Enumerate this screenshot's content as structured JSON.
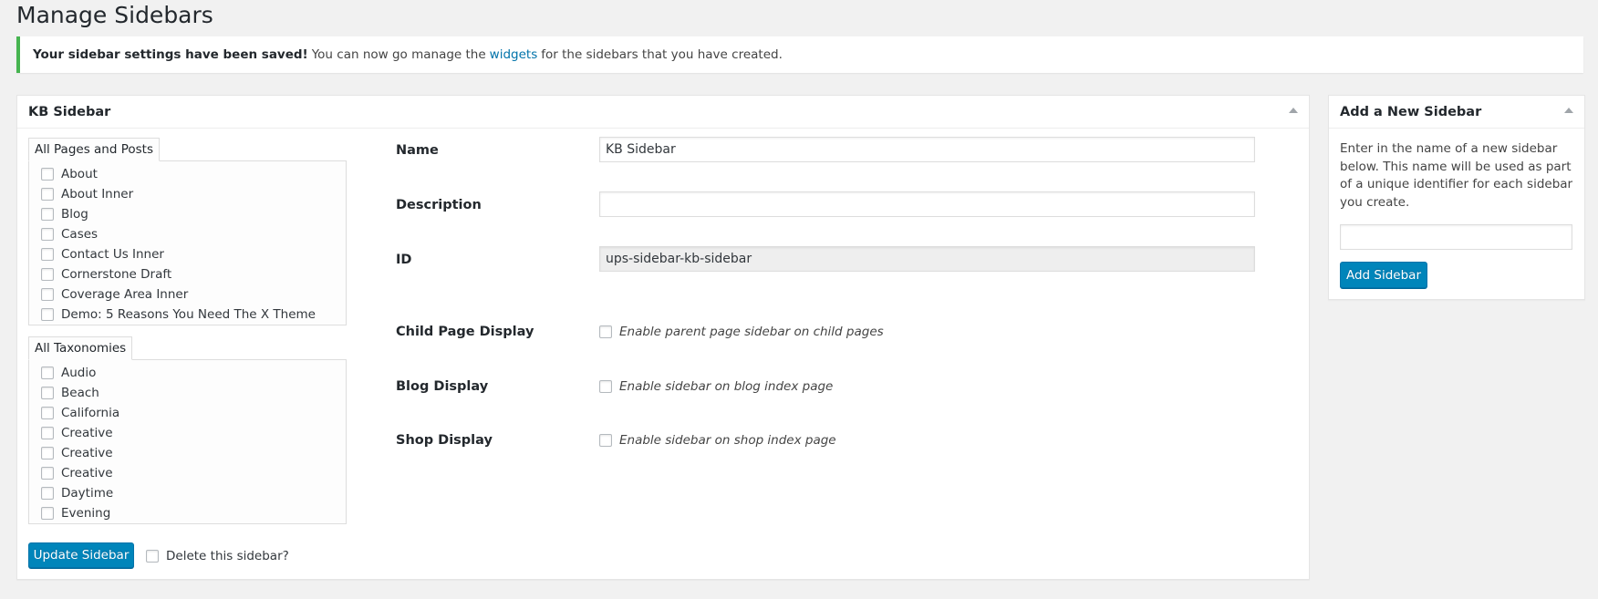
{
  "page": {
    "title": "Manage Sidebars"
  },
  "notice": {
    "bold": "Your sidebar settings have been saved!",
    "text_before": "You can now go manage the",
    "link": "widgets",
    "text_after": "for the sidebars that you have created."
  },
  "main_panel": {
    "title": "KB Sidebar",
    "pages_tab": {
      "label": "All Pages and Posts",
      "items": [
        "About",
        "About Inner",
        "Blog",
        "Cases",
        "Contact Us Inner",
        "Cornerstone Draft",
        "Coverage Area Inner",
        "Demo: 5 Reasons You Need The X Theme"
      ]
    },
    "taxonomies_tab": {
      "label": "All Taxonomies",
      "items": [
        "Audio",
        "Beach",
        "California",
        "Creative",
        "Creative",
        "Creative",
        "Daytime",
        "Evening"
      ]
    },
    "fields": {
      "name_label": "Name",
      "name_value": "KB Sidebar",
      "description_label": "Description",
      "description_value": "",
      "id_label": "ID",
      "id_value": "ups-sidebar-kb-sidebar",
      "child_label": "Child Page Display",
      "child_option": "Enable parent page sidebar on child pages",
      "blog_label": "Blog Display",
      "blog_option": "Enable sidebar on blog index page",
      "shop_label": "Shop Display",
      "shop_option": "Enable sidebar on shop index page"
    },
    "update_button": "Update Sidebar",
    "delete_label": "Delete this sidebar?"
  },
  "side_panel": {
    "title": "Add a New Sidebar",
    "description": "Enter in the name of a new sidebar below. This name will be used as part of a unique identifier for each sidebar you create.",
    "input_value": "",
    "add_button": "Add Sidebar"
  },
  "colors": {
    "accent": "#0085ba",
    "notice_border": "#46b450",
    "link": "#0073aa"
  }
}
